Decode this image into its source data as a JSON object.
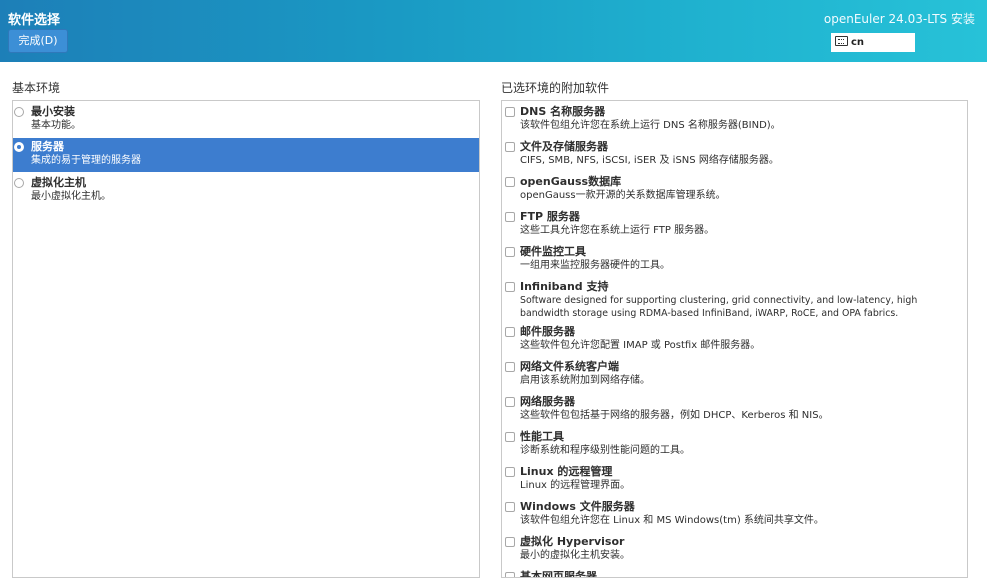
{
  "header": {
    "title": "软件选择",
    "done_label": "完成(D)",
    "product": "openEuler 24.03-LTS 安装",
    "keyboard_layout": "cn"
  },
  "base_env": {
    "heading": "基本环境",
    "items": [
      {
        "title": "最小安装",
        "desc": "基本功能。",
        "selected": false
      },
      {
        "title": "服务器",
        "desc": "集成的易于管理的服务器",
        "selected": true
      },
      {
        "title": "虚拟化主机",
        "desc": "最小虚拟化主机。",
        "selected": false
      }
    ]
  },
  "addons": {
    "heading": "已选环境的附加软件",
    "items": [
      {
        "title": "DNS 名称服务器",
        "desc": "该软件包组允许您在系统上运行 DNS 名称服务器(BIND)。",
        "checked": false
      },
      {
        "title": "文件及存储服务器",
        "desc": "CIFS, SMB, NFS, iSCSI, iSER 及 iSNS 网络存储服务器。",
        "checked": false
      },
      {
        "title": "openGauss数据库",
        "desc": "openGauss一款开源的关系数据库管理系统。",
        "checked": false
      },
      {
        "title": "FTP 服务器",
        "desc": "这些工具允许您在系统上运行 FTP 服务器。",
        "checked": false
      },
      {
        "title": "硬件监控工具",
        "desc": "一组用来监控服务器硬件的工具。",
        "checked": false
      },
      {
        "title": "Infiniband 支持",
        "desc": "Software designed for supporting clustering, grid connectivity, and low-latency, high bandwidth storage using RDMA-based InfiniBand, iWARP, RoCE, and OPA fabrics.",
        "checked": false
      },
      {
        "title": "邮件服务器",
        "desc": "这些软件包允许您配置 IMAP 或 Postfix 邮件服务器。",
        "checked": false
      },
      {
        "title": "网络文件系统客户端",
        "desc": "启用该系统附加到网络存储。",
        "checked": false
      },
      {
        "title": "网络服务器",
        "desc": "这些软件包包括基于网络的服务器，例如 DHCP、Kerberos 和 NIS。",
        "checked": false
      },
      {
        "title": "性能工具",
        "desc": "诊断系统和程序级别性能问题的工具。",
        "checked": false
      },
      {
        "title": "Linux 的远程管理",
        "desc": "Linux 的远程管理界面。",
        "checked": false
      },
      {
        "title": "Windows 文件服务器",
        "desc": "该软件包组允许您在 Linux 和 MS Windows(tm) 系统间共享文件。",
        "checked": false
      },
      {
        "title": "虚拟化 Hypervisor",
        "desc": "最小的虚拟化主机安装。",
        "checked": false
      },
      {
        "title": "基本网页服务器",
        "desc": "",
        "checked": false
      }
    ]
  }
}
